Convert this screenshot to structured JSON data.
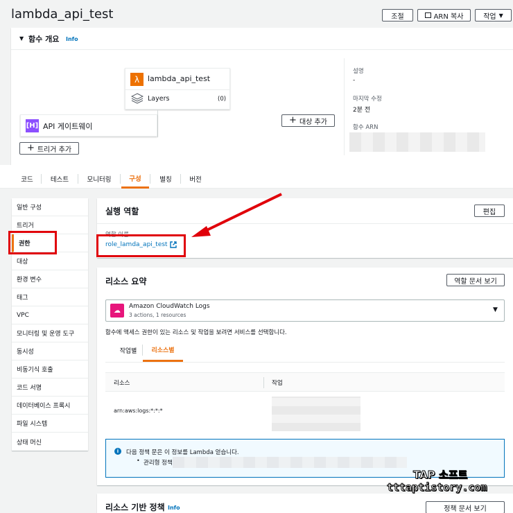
{
  "header": {
    "title": "lambda_api_test",
    "adjust_label": "조절",
    "copy_arn_label": "ARN 복사",
    "actions_label": "작업"
  },
  "overview": {
    "title": "함수 개요",
    "info": "Info",
    "function_name": "lambda_api_test",
    "layers_label": "Layers",
    "layers_count": "(0)",
    "trigger_name": "API 게이트웨이",
    "add_trigger": "트리거 추가",
    "add_destination": "대상 추가",
    "description_label": "설명",
    "description_value": "-",
    "last_modified_label": "마지막 수정",
    "last_modified_value": "2분 전",
    "arn_label": "함수 ARN"
  },
  "tabs": [
    {
      "label": "코드"
    },
    {
      "label": "테스트"
    },
    {
      "label": "모니터링"
    },
    {
      "label": "구성"
    },
    {
      "label": "별칭"
    },
    {
      "label": "버전"
    }
  ],
  "sidebar": {
    "items": [
      {
        "label": "일반 구성"
      },
      {
        "label": "트리거"
      },
      {
        "label": "권한"
      },
      {
        "label": "대상"
      },
      {
        "label": "환경 변수"
      },
      {
        "label": "태그"
      },
      {
        "label": "VPC"
      },
      {
        "label": "모니터링 및 운영 도구"
      },
      {
        "label": "동시성"
      },
      {
        "label": "비동기식 호출"
      },
      {
        "label": "코드 서명"
      },
      {
        "label": "데이터베이스 프록시"
      },
      {
        "label": "파일 시스템"
      },
      {
        "label": "상태 머신"
      }
    ]
  },
  "execution_role": {
    "title": "실행 역할",
    "edit_label": "편집",
    "role_name_label": "역할 이름",
    "role_name": "role_lamda_api_test"
  },
  "resource_summary": {
    "title": "리소스 요약",
    "view_policy": "역할 문서 보기",
    "service_name": "Amazon CloudWatch Logs",
    "service_sub": "3 actions, 1 resources",
    "hint": "함수에 액세스 권한이 있는 리소스 및 작업을 보려면 서비스를 선택합니다.",
    "tab_by_action": "작업별",
    "tab_by_resource": "리소스별",
    "col_resource": "리소스",
    "col_action": "작업",
    "resource_value": "arn:aws:logs:*:*:*",
    "info_line": "다음 정책 문은 이 정보를 Lambda 얻습니다.",
    "info_bullet": "관리형 정책"
  },
  "resource_policy": {
    "title": "리소스 기반 정책",
    "info": "Info",
    "view_policy": "정책 문서 보기"
  },
  "watermark": {
    "line1": "TAP 소프트",
    "line2": "tttaptistory.com"
  },
  "colors": {
    "accent_orange": "#ec7211",
    "link_blue": "#0073bb",
    "highlight_red": "#e0000a",
    "lambda_orange": "#ed7100",
    "api_purple": "#8c4fff",
    "cloudwatch_pink": "#e7157b"
  }
}
